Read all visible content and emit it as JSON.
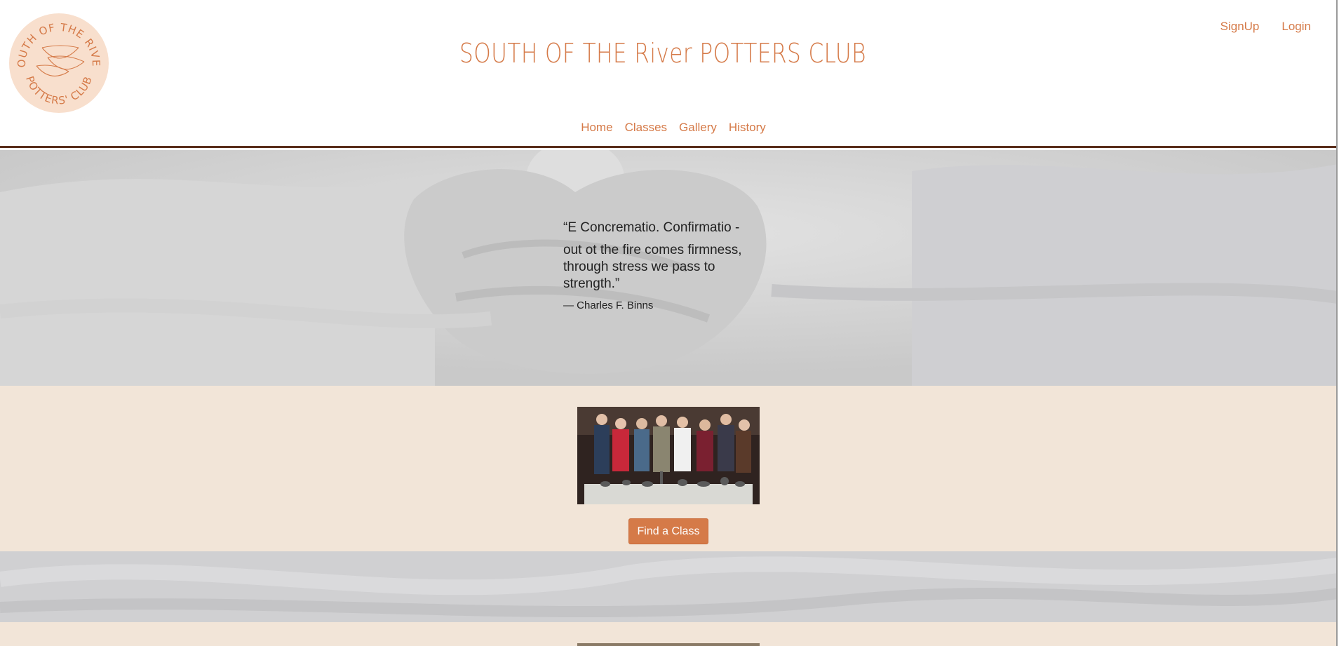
{
  "logo": {
    "text_top": "SOUTH OF THE RIVER",
    "text_bottom": "POTTERS' CLUB",
    "fill_color": "#f8dfcd",
    "ink_color": "#d57a48"
  },
  "header": {
    "title": "SOUTH OF THE River POTTERS CLUB",
    "auth": {
      "signup": "SignUp",
      "login": "Login"
    },
    "nav": [
      {
        "label": "Home"
      },
      {
        "label": "Classes"
      },
      {
        "label": "Gallery"
      },
      {
        "label": "History"
      }
    ]
  },
  "hero": {
    "quote_line1": "“E Concrematio. Confirmatio -",
    "quote_rest": "out ot the fire comes firmness, through stress we pass to strength.”",
    "citation": "— Charles F. Binns"
  },
  "feature": {
    "button_label": "Find a Class",
    "photo_icon": "group-photo"
  },
  "colors": {
    "accent": "#d57a48",
    "header_border": "#5a2e1c",
    "band_bg": "#f2e5d8",
    "text": "#222222"
  }
}
